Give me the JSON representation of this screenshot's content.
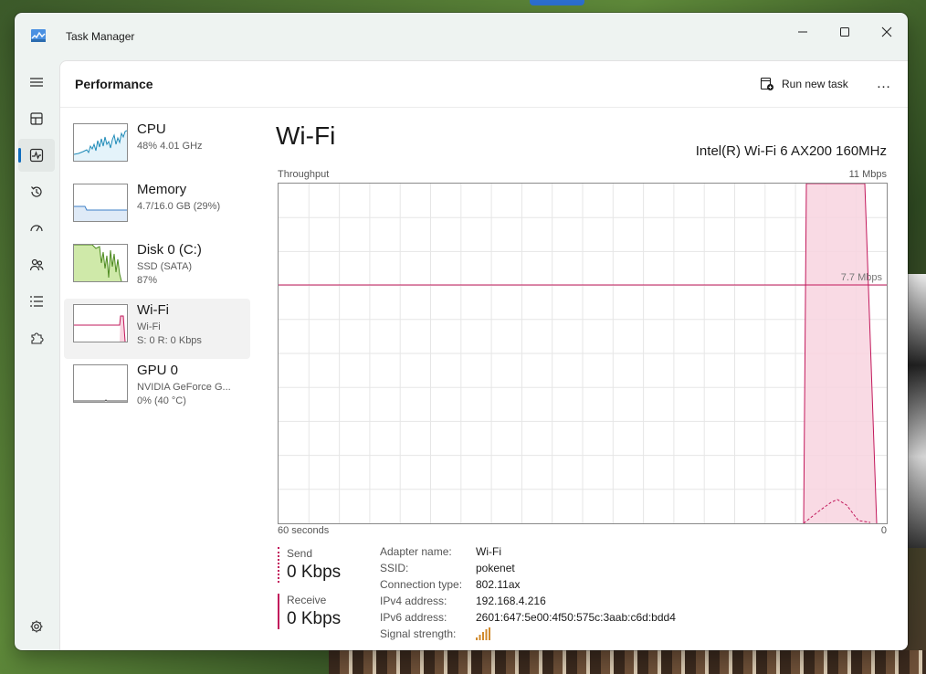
{
  "window": {
    "title": "Task Manager"
  },
  "header": {
    "title": "Performance",
    "run_task_label": "Run new task",
    "more_label": "…"
  },
  "nav": [
    "hamburger-menu",
    "processes",
    "performance",
    "app-history",
    "startup-apps",
    "users",
    "details",
    "services",
    "settings"
  ],
  "sidebar_items": [
    {
      "name": "CPU",
      "line1": "48% 4.01 GHz",
      "line2": "",
      "color": "#1f8bb8",
      "fill": "#e4f3fa"
    },
    {
      "name": "Memory",
      "line1": "4.7/16.0 GB (29%)",
      "line2": "",
      "color": "#3d7fc7",
      "fill": "#dfeaf7"
    },
    {
      "name": "Disk 0 (C:)",
      "line1": "SSD (SATA)",
      "line2": "87%",
      "color": "#4d8a20",
      "fill": "#cfe9a9"
    },
    {
      "name": "Wi-Fi",
      "line1": "Wi-Fi",
      "line2": "S: 0 R: 0 Kbps",
      "color": "#c2185b",
      "fill": "#f8d3df"
    },
    {
      "name": "GPU 0",
      "line1": "NVIDIA GeForce G...",
      "line2": "0% (40 °C)",
      "color": "#555555",
      "fill": "#ffffff"
    }
  ],
  "detail": {
    "title": "Wi-Fi",
    "adapter": "Intel(R) Wi-Fi 6 AX200 160MHz",
    "throughput_label": "Throughput",
    "max_label": "11 Mbps",
    "ref_label": "7.7 Mbps",
    "axis_left": "60 seconds",
    "axis_right": "0",
    "send": {
      "label": "Send",
      "value": "0 Kbps"
    },
    "receive": {
      "label": "Receive",
      "value": "0 Kbps"
    },
    "properties": [
      {
        "label": "Adapter name:",
        "value": "Wi-Fi"
      },
      {
        "label": "SSID:",
        "value": "pokenet"
      },
      {
        "label": "Connection type:",
        "value": "802.11ax"
      },
      {
        "label": "IPv4 address:",
        "value": "192.168.4.216"
      },
      {
        "label": "IPv6 address:",
        "value": "2601:647:5e00:4f50:575c:3aab:c6d:bdd4"
      },
      {
        "label": "Signal strength:",
        "value": ""
      }
    ],
    "colors": {
      "accent": "#c2185b",
      "fill": "#f8d3df",
      "grid": "#e6e6e6"
    }
  }
}
